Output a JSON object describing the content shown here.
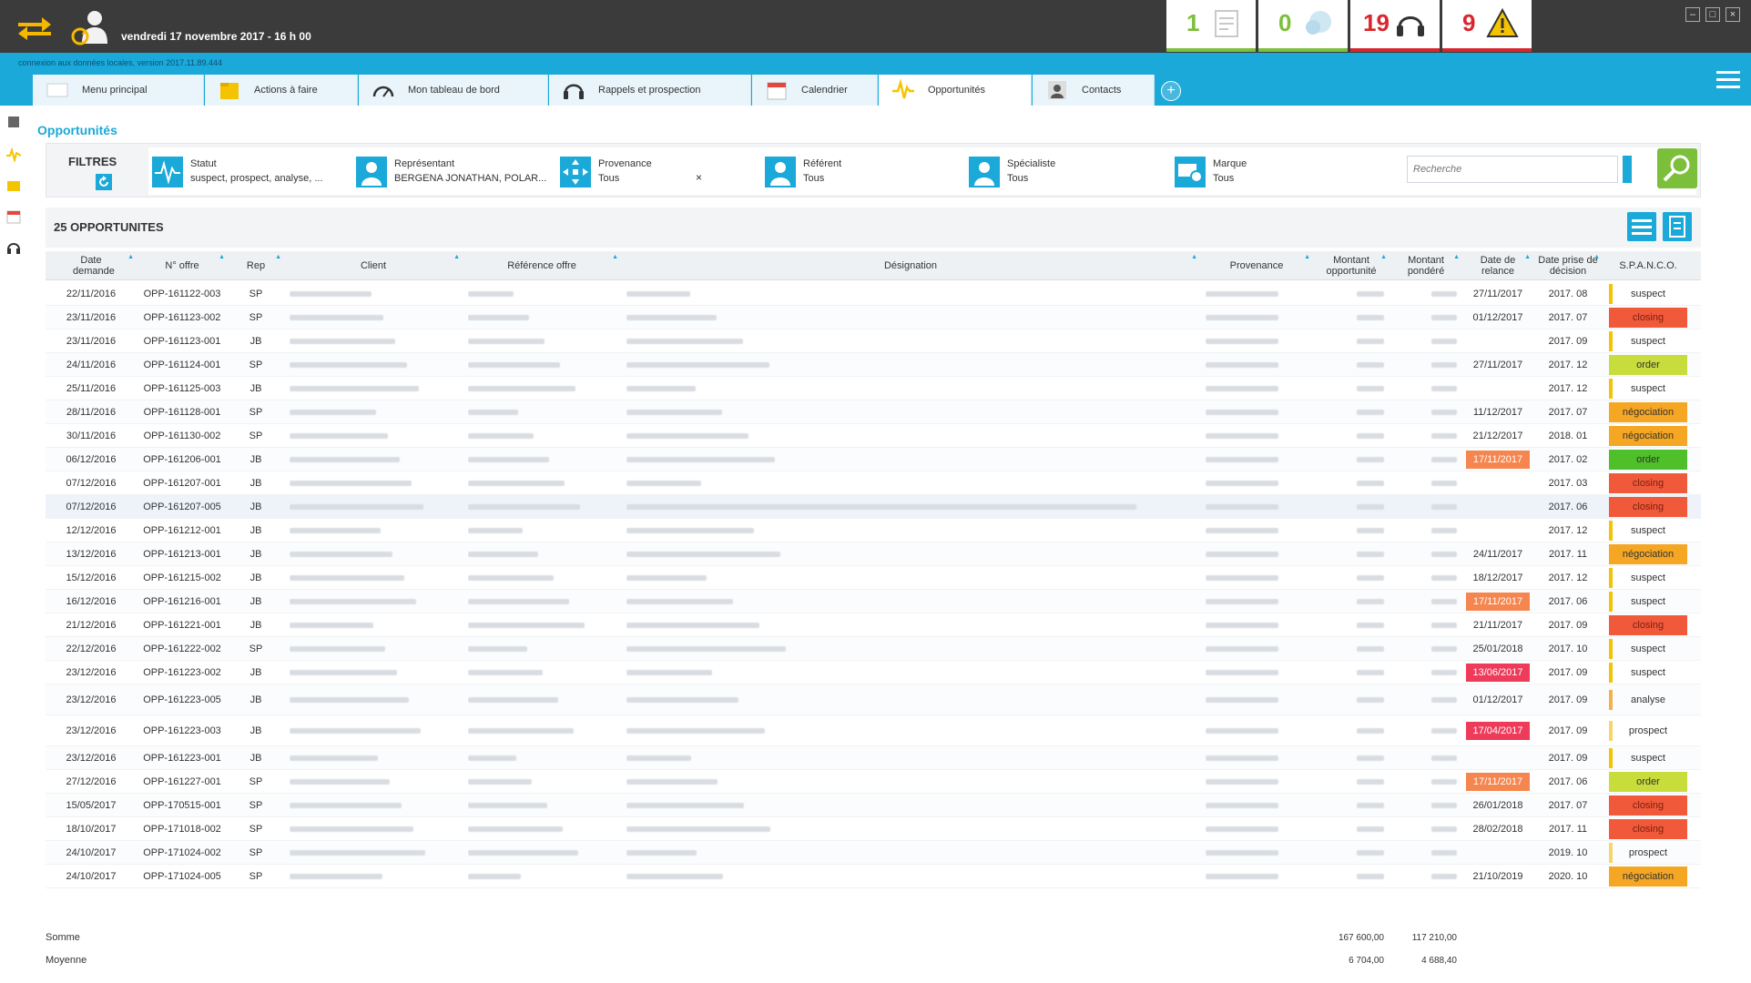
{
  "header": {
    "datetime": "vendredi 17 novembre 2017 - 16 h 00",
    "counters": [
      {
        "value": "1",
        "icon": "news-icon",
        "color": "#7bbf3a"
      },
      {
        "value": "0",
        "icon": "chat-icon",
        "color": "#7bbf3a"
      },
      {
        "value": "19",
        "icon": "headset-icon",
        "color": "#d9262c"
      },
      {
        "value": "9",
        "icon": "warning-icon",
        "color": "#d9262c"
      }
    ]
  },
  "status_line": "connexion aux données locales, version 2017.11.89.444",
  "tabs": [
    {
      "label": "Menu principal"
    },
    {
      "label": "Actions à faire"
    },
    {
      "label": "Mon tableau de bord"
    },
    {
      "label": "Rappels et prospection"
    },
    {
      "label": "Calendrier"
    },
    {
      "label": "Opportunités"
    },
    {
      "label": "Contacts"
    }
  ],
  "page_title": "Opportunités",
  "filters": {
    "title": "FILTRES",
    "items": [
      {
        "label": "Statut",
        "value": "suspect, prospect, analyse, ..."
      },
      {
        "label": "Représentant",
        "value": "BERGENA JONATHAN, POLAR..."
      },
      {
        "label": "Provenance",
        "value": "Tous"
      },
      {
        "label": "Référent",
        "value": "Tous"
      },
      {
        "label": "Spécialiste",
        "value": "Tous"
      },
      {
        "label": "Marque",
        "value": "Tous"
      }
    ],
    "clear": "×",
    "search_placeholder": "Recherche"
  },
  "list": {
    "count_label": "25 OPPORTUNITES",
    "columns": [
      "Date demande",
      "N° offre",
      "Rep",
      "Client",
      "Référence offre",
      "Désignation",
      "Provenance",
      "Montant opportunité",
      "Montant pondéré",
      "Date de relance",
      "Date prise de décision",
      "S.P.A.N.C.O."
    ],
    "rows": [
      {
        "date": "22/11/2016",
        "offre": "OPP-161122-003",
        "rep": "SP",
        "relance": "27/11/2017",
        "decision": "2017. 08",
        "status": "suspect"
      },
      {
        "date": "23/11/2016",
        "offre": "OPP-161123-002",
        "rep": "SP",
        "relance": "01/12/2017",
        "decision": "2017. 07",
        "status": "closing"
      },
      {
        "date": "23/11/2016",
        "offre": "OPP-161123-001",
        "rep": "JB",
        "relance": "",
        "decision": "2017. 09",
        "status": "suspect"
      },
      {
        "date": "24/11/2016",
        "offre": "OPP-161124-001",
        "rep": "SP",
        "relance": "27/11/2017",
        "decision": "2017. 12",
        "status": "order"
      },
      {
        "date": "25/11/2016",
        "offre": "OPP-161125-003",
        "rep": "JB",
        "relance": "",
        "decision": "2017. 12",
        "status": "suspect"
      },
      {
        "date": "28/11/2016",
        "offre": "OPP-161128-001",
        "rep": "SP",
        "relance": "11/12/2017",
        "decision": "2017. 07",
        "status": "négociation"
      },
      {
        "date": "30/11/2016",
        "offre": "OPP-161130-002",
        "rep": "SP",
        "relance": "21/12/2017",
        "decision": "2018. 01",
        "status": "négociation"
      },
      {
        "date": "06/12/2016",
        "offre": "OPP-161206-001",
        "rep": "JB",
        "relance": "17/11/2017",
        "decision": "2017. 02",
        "status": "order"
      },
      {
        "date": "07/12/2016",
        "offre": "OPP-161207-001",
        "rep": "JB",
        "relance": "",
        "decision": "2017. 03",
        "status": "closing"
      },
      {
        "date": "07/12/2016",
        "offre": "OPP-161207-005",
        "rep": "JB",
        "relance": "",
        "decision": "2017. 06",
        "status": "closing"
      },
      {
        "date": "12/12/2016",
        "offre": "OPP-161212-001",
        "rep": "JB",
        "relance": "",
        "decision": "2017. 12",
        "status": "suspect"
      },
      {
        "date": "13/12/2016",
        "offre": "OPP-161213-001",
        "rep": "JB",
        "relance": "24/11/2017",
        "decision": "2017. 11",
        "status": "négociation"
      },
      {
        "date": "15/12/2016",
        "offre": "OPP-161215-002",
        "rep": "JB",
        "relance": "18/12/2017",
        "decision": "2017. 12",
        "status": "suspect"
      },
      {
        "date": "16/12/2016",
        "offre": "OPP-161216-001",
        "rep": "JB",
        "relance": "17/11/2017",
        "decision": "2017. 06",
        "status": "suspect"
      },
      {
        "date": "21/12/2016",
        "offre": "OPP-161221-001",
        "rep": "JB",
        "relance": "21/11/2017",
        "decision": "2017. 09",
        "status": "closing"
      },
      {
        "date": "22/12/2016",
        "offre": "OPP-161222-002",
        "rep": "SP",
        "relance": "25/01/2018",
        "decision": "2017. 10",
        "status": "suspect"
      },
      {
        "date": "23/12/2016",
        "offre": "OPP-161223-002",
        "rep": "JB",
        "relance": "13/06/2017",
        "decision": "2017. 09",
        "status": "suspect"
      },
      {
        "date": "23/12/2016",
        "offre": "OPP-161223-005",
        "rep": "JB",
        "relance": "01/12/2017",
        "decision": "2017. 09",
        "status": "analyse"
      },
      {
        "date": "23/12/2016",
        "offre": "OPP-161223-003",
        "rep": "JB",
        "relance": "17/04/2017",
        "decision": "2017. 09",
        "status": "prospect"
      },
      {
        "date": "23/12/2016",
        "offre": "OPP-161223-001",
        "rep": "JB",
        "relance": "",
        "decision": "2017. 09",
        "status": "suspect"
      },
      {
        "date": "27/12/2016",
        "offre": "OPP-161227-001",
        "rep": "SP",
        "relance": "17/11/2017",
        "decision": "2017. 06",
        "status": "order"
      },
      {
        "date": "15/05/2017",
        "offre": "OPP-170515-001",
        "rep": "SP",
        "relance": "26/01/2018",
        "decision": "2017. 07",
        "status": "closing"
      },
      {
        "date": "18/10/2017",
        "offre": "OPP-171018-002",
        "rep": "SP",
        "relance": "28/02/2018",
        "decision": "2017. 11",
        "status": "closing"
      },
      {
        "date": "24/10/2017",
        "offre": "OPP-171024-002",
        "rep": "SP",
        "relance": "",
        "decision": "2019. 10",
        "status": "prospect"
      },
      {
        "date": "24/10/2017",
        "offre": "OPP-171024-005",
        "rep": "SP",
        "relance": "21/10/2019",
        "decision": "2020. 10",
        "status": "négociation"
      }
    ]
  },
  "footer": {
    "sum_label": "Somme",
    "avg_label": "Moyenne",
    "sum_opportunite": "167 600,00",
    "sum_pondere": "117 210,00",
    "avg_opportunite": "6 704,00",
    "avg_pondere": "4 688,40"
  },
  "colors": {
    "accent": "#1aa9d8",
    "green": "#7bbf3a",
    "closing": "#f05a3a",
    "order_light": "#c8dc3c",
    "order": "#4fbf2a",
    "negociation": "#f5a623",
    "relance_orange": "#f5864f",
    "relance_red": "#ee3b5a"
  }
}
